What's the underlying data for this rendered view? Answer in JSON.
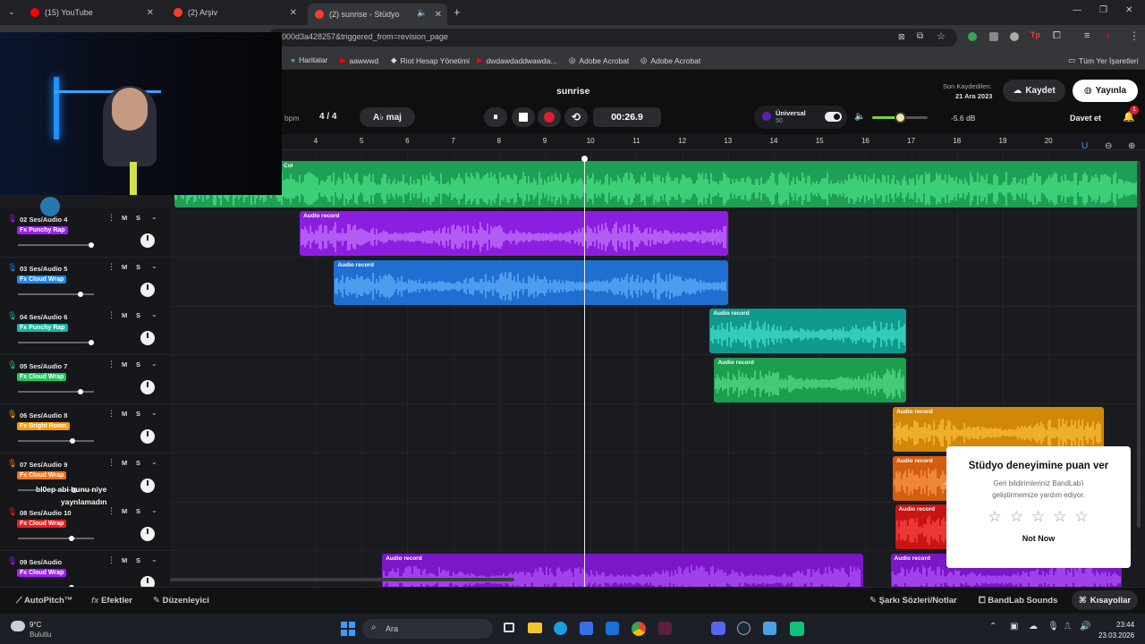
{
  "browser": {
    "tabs": [
      {
        "title": "(15) YouTube",
        "color": "#ff0000"
      },
      {
        "title": "(2) Arşiv",
        "color": "#ff3b30"
      },
      {
        "title": "(2) sunrise - Stüdyo",
        "color": "#ff3b30"
      }
    ],
    "url": "000d3a428257&triggered_from=revision_page",
    "bookmarks": [
      "Haritalar",
      "aawwwd",
      "Riot Hesap Yönetimi",
      "dwdawdaddwawda...",
      "Adobe Acrobat",
      "Adobe Acrobat",
      "Tüm Yer İşaretleri"
    ]
  },
  "studio": {
    "project_title": "sunrise",
    "last_saved_label": "Son Kaydedilen:",
    "last_saved_date": "21 Ara 2023",
    "save_label": "Kaydet",
    "publish_label": "Yayınla",
    "invite_label": "Davet et",
    "notif_count": "1",
    "bpm_label": "bpm",
    "time_signature": "4 / 4",
    "key": "A♭ maj",
    "time": "00:26.9",
    "preset_name": "Üniversal",
    "preset_sub": "50",
    "master_db": "-5.6 dB",
    "master_volume": 0.5,
    "ruler": [
      "4",
      "5",
      "6",
      "7",
      "8",
      "9",
      "10",
      "11",
      "12",
      "13",
      "14",
      "15",
      "16",
      "17",
      "18",
      "19",
      "20"
    ]
  },
  "tracks": [
    {
      "num": "02",
      "name": "Ses/Audio 4",
      "fx": "Fx Punchy Rap",
      "color": "#a020f0"
    },
    {
      "num": "03",
      "name": "Ses/Audio 5",
      "fx": "Fx Cloud Wrap",
      "color": "#1e88e5"
    },
    {
      "num": "04",
      "name": "Ses/Audio 6",
      "fx": "Fx Punchy Rap",
      "color": "#14b8a6"
    },
    {
      "num": "05",
      "name": "Ses/Audio 7",
      "fx": "Fx Cloud Wrap",
      "color": "#22c55e"
    },
    {
      "num": "06",
      "name": "Ses/Audio 8",
      "fx": "Fx Bright Room",
      "color": "#f59e0b"
    },
    {
      "num": "07",
      "name": "Ses/Audio 9",
      "fx": "Fx Cloud Wrap",
      "color": "#f97316"
    },
    {
      "num": "08",
      "name": "Ses/Audio 10",
      "fx": "Fx Cloud Wrap",
      "color": "#ef1c1c"
    },
    {
      "num": "09",
      "name": "Ses/Audio",
      "fx": "Fx Cloud Wrap",
      "color": "#a020f0"
    }
  ],
  "clips": {
    "label": "Audio record",
    "top_label": "Col"
  },
  "chat_overlay": {
    "line1": "bl0ep  abi bunu niye",
    "line2": "yaynlamadın"
  },
  "bottom": {
    "autopitch": "AutoPitch™",
    "effects": "Efektler",
    "editor": "Düzenleyici",
    "lyrics": "Şarkı Sözleri/Notlar",
    "sounds": "BandLab Sounds",
    "shortcuts": "Kısayollar"
  },
  "rating": {
    "title": "Stüdyo deneyimine puan ver",
    "desc_line1": "Geri bildirimleriniz BandLab'i",
    "desc_line2": "geliştirmemize yardım ediyor.",
    "not_now": "Not Now"
  },
  "taskbar": {
    "weather_temp": "9°C",
    "weather_desc": "Bulutlu",
    "search": "Ara",
    "time": "23:44",
    "date": "23.03.2026"
  }
}
